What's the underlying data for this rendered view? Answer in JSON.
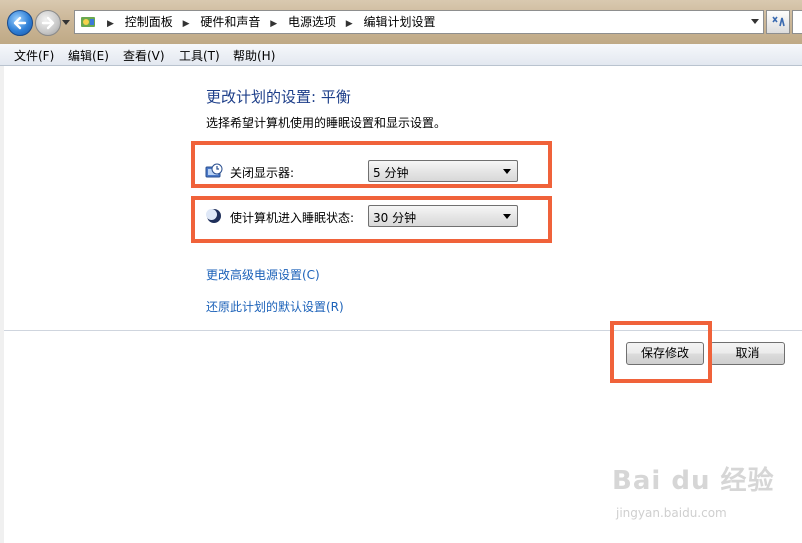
{
  "address_bar": {
    "breadcrumbs": [
      "控制面板",
      "硬件和声音",
      "电源选项",
      "编辑计划设置"
    ]
  },
  "menu": [
    "文件(F)",
    "编辑(E)",
    "查看(V)",
    "工具(T)",
    "帮助(H)"
  ],
  "page": {
    "title": "更改计划的设置: 平衡",
    "subtitle": "选择希望计算机使用的睡眠设置和显示设置。"
  },
  "settings": {
    "display_off": {
      "label": "关闭显示器:",
      "value": "5 分钟"
    },
    "sleep": {
      "label": "使计算机进入睡眠状态:",
      "value": "30 分钟"
    }
  },
  "links": {
    "advanced": "更改高级电源设置(C)",
    "restore": "还原此计划的默认设置(R)"
  },
  "buttons": {
    "save": "保存修改",
    "cancel": "取消"
  },
  "watermark": {
    "logo": "Bai du 经验",
    "url": "jingyan.baidu.com"
  },
  "colors": {
    "highlight": "#f0623a",
    "link": "#1c62b9",
    "title": "#1e3f8a"
  }
}
